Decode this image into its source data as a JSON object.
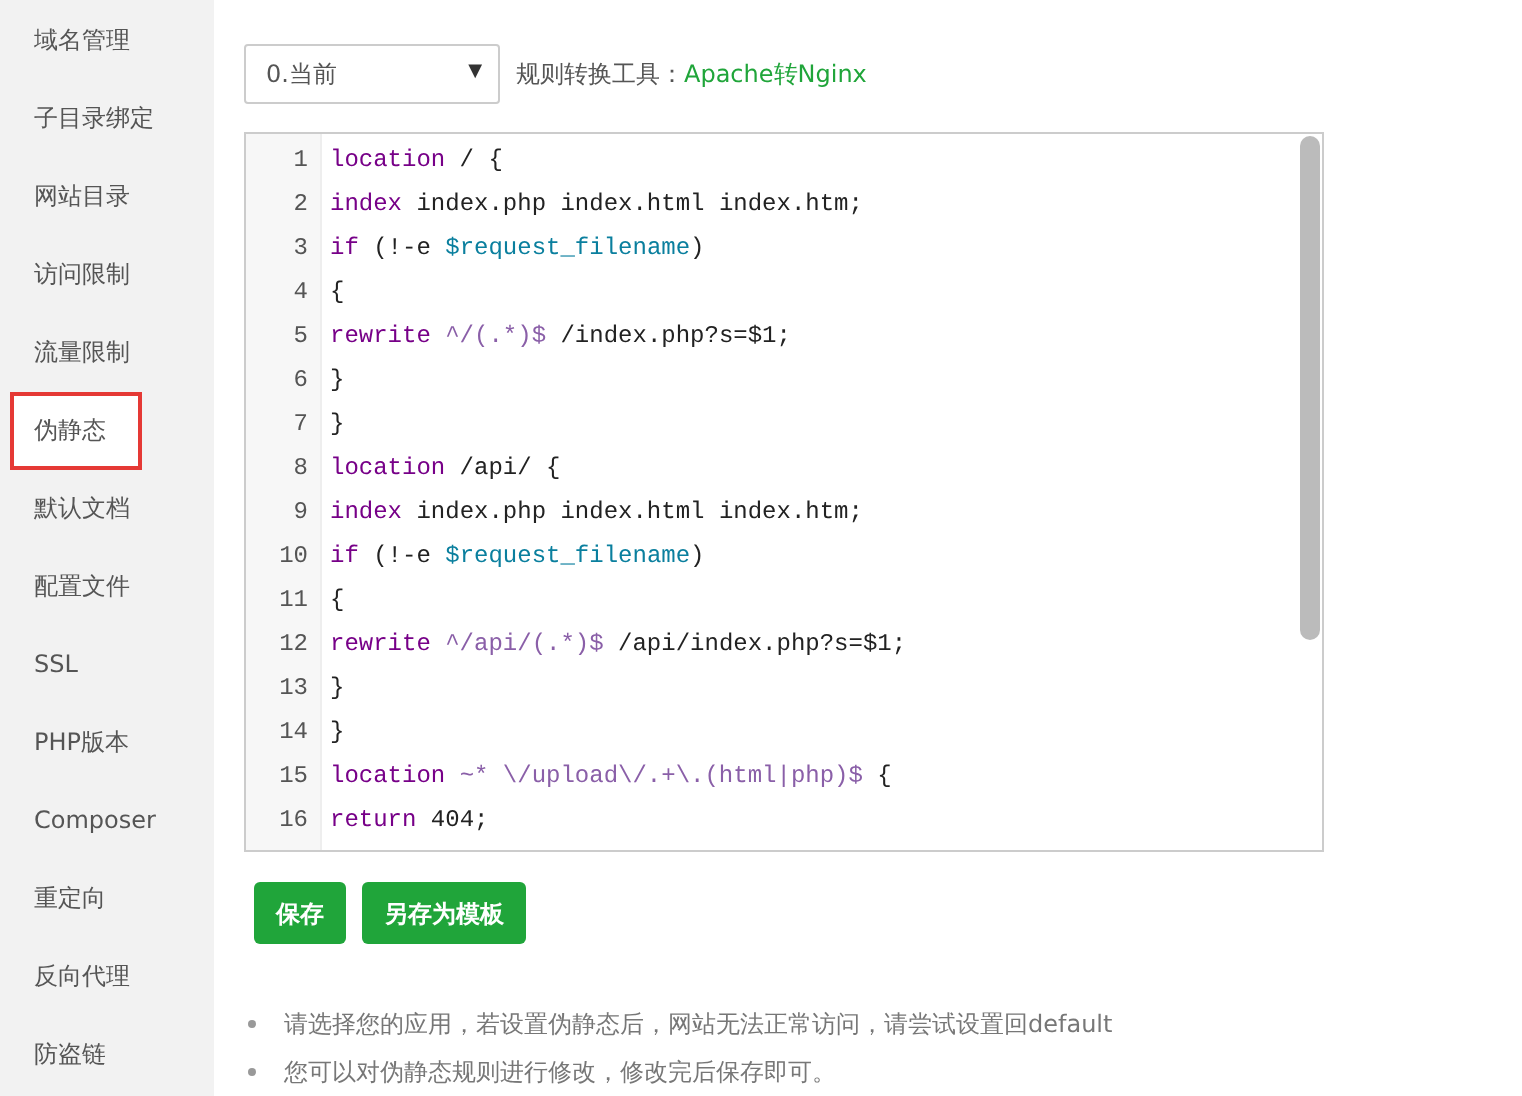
{
  "sidebar": {
    "items": [
      {
        "label": "域名管理",
        "selected": false,
        "highlighted": false
      },
      {
        "label": "子目录绑定",
        "selected": false,
        "highlighted": false
      },
      {
        "label": "网站目录",
        "selected": false,
        "highlighted": false
      },
      {
        "label": "访问限制",
        "selected": false,
        "highlighted": false
      },
      {
        "label": "流量限制",
        "selected": false,
        "highlighted": false
      },
      {
        "label": "伪静态",
        "selected": true,
        "highlighted": true
      },
      {
        "label": "默认文档",
        "selected": false,
        "highlighted": false
      },
      {
        "label": "配置文件",
        "selected": false,
        "highlighted": false
      },
      {
        "label": "SSL",
        "selected": false,
        "highlighted": false
      },
      {
        "label": "PHP版本",
        "selected": false,
        "highlighted": false
      },
      {
        "label": "Composer",
        "selected": false,
        "highlighted": false
      },
      {
        "label": "重定向",
        "selected": false,
        "highlighted": false
      },
      {
        "label": "反向代理",
        "selected": false,
        "highlighted": false
      },
      {
        "label": "防盗链",
        "selected": false,
        "highlighted": false
      }
    ]
  },
  "template_select": {
    "value": "0.当前",
    "caret": "▼"
  },
  "converter": {
    "label": "规则转换工具：",
    "link": "Apache转Nginx"
  },
  "editor": {
    "lines": [
      {
        "number": "1",
        "tokens": [
          {
            "kind": "keyword",
            "text": "location"
          },
          {
            "kind": "plain",
            "text": " / {"
          }
        ]
      },
      {
        "number": "2",
        "tokens": [
          {
            "kind": "keyword",
            "text": "index"
          },
          {
            "kind": "plain",
            "text": " index.php index.html index.htm;"
          }
        ]
      },
      {
        "number": "3",
        "tokens": [
          {
            "kind": "keyword",
            "text": "if"
          },
          {
            "kind": "plain",
            "text": " (!-e "
          },
          {
            "kind": "variable",
            "text": "$request_filename"
          },
          {
            "kind": "plain",
            "text": ")"
          }
        ]
      },
      {
        "number": "4",
        "tokens": [
          {
            "kind": "plain",
            "text": "{"
          }
        ]
      },
      {
        "number": "5",
        "tokens": [
          {
            "kind": "keyword",
            "text": "rewrite "
          },
          {
            "kind": "regex",
            "text": "^/(.*)$"
          },
          {
            "kind": "plain",
            "text": " /index.php?s=$1;"
          }
        ]
      },
      {
        "number": "6",
        "tokens": [
          {
            "kind": "plain",
            "text": "}"
          }
        ]
      },
      {
        "number": "7",
        "tokens": [
          {
            "kind": "plain",
            "text": "}"
          }
        ]
      },
      {
        "number": "8",
        "tokens": [
          {
            "kind": "keyword",
            "text": "location"
          },
          {
            "kind": "plain",
            "text": " /api/ {"
          }
        ]
      },
      {
        "number": "9",
        "tokens": [
          {
            "kind": "keyword",
            "text": "index"
          },
          {
            "kind": "plain",
            "text": " index.php index.html index.htm;"
          }
        ]
      },
      {
        "number": "10",
        "tokens": [
          {
            "kind": "keyword",
            "text": "if"
          },
          {
            "kind": "plain",
            "text": " (!-e "
          },
          {
            "kind": "variable",
            "text": "$request_filename"
          },
          {
            "kind": "plain",
            "text": ")"
          }
        ]
      },
      {
        "number": "11",
        "tokens": [
          {
            "kind": "plain",
            "text": "{"
          }
        ]
      },
      {
        "number": "12",
        "tokens": [
          {
            "kind": "keyword",
            "text": "rewrite "
          },
          {
            "kind": "regex",
            "text": "^/api/(.*)$"
          },
          {
            "kind": "plain",
            "text": " /api/index.php?s=$1;"
          }
        ]
      },
      {
        "number": "13",
        "tokens": [
          {
            "kind": "plain",
            "text": "}"
          }
        ]
      },
      {
        "number": "14",
        "tokens": [
          {
            "kind": "plain",
            "text": "}"
          }
        ]
      },
      {
        "number": "15",
        "tokens": [
          {
            "kind": "keyword",
            "text": "location "
          },
          {
            "kind": "regex",
            "text": "~* \\/upload\\/.+\\.(html|php)$"
          },
          {
            "kind": "plain",
            "text": " {"
          }
        ]
      },
      {
        "number": "16",
        "tokens": [
          {
            "kind": "keyword",
            "text": "return"
          },
          {
            "kind": "plain",
            "text": " 404;"
          }
        ]
      }
    ]
  },
  "buttons": [
    "保存",
    "另存为模板"
  ],
  "notes": [
    "请选择您的应用，若设置伪静态后，网站无法正常访问，请尝试设置回default",
    "您可以对伪静态规则进行修改，修改完后保存即可。"
  ]
}
